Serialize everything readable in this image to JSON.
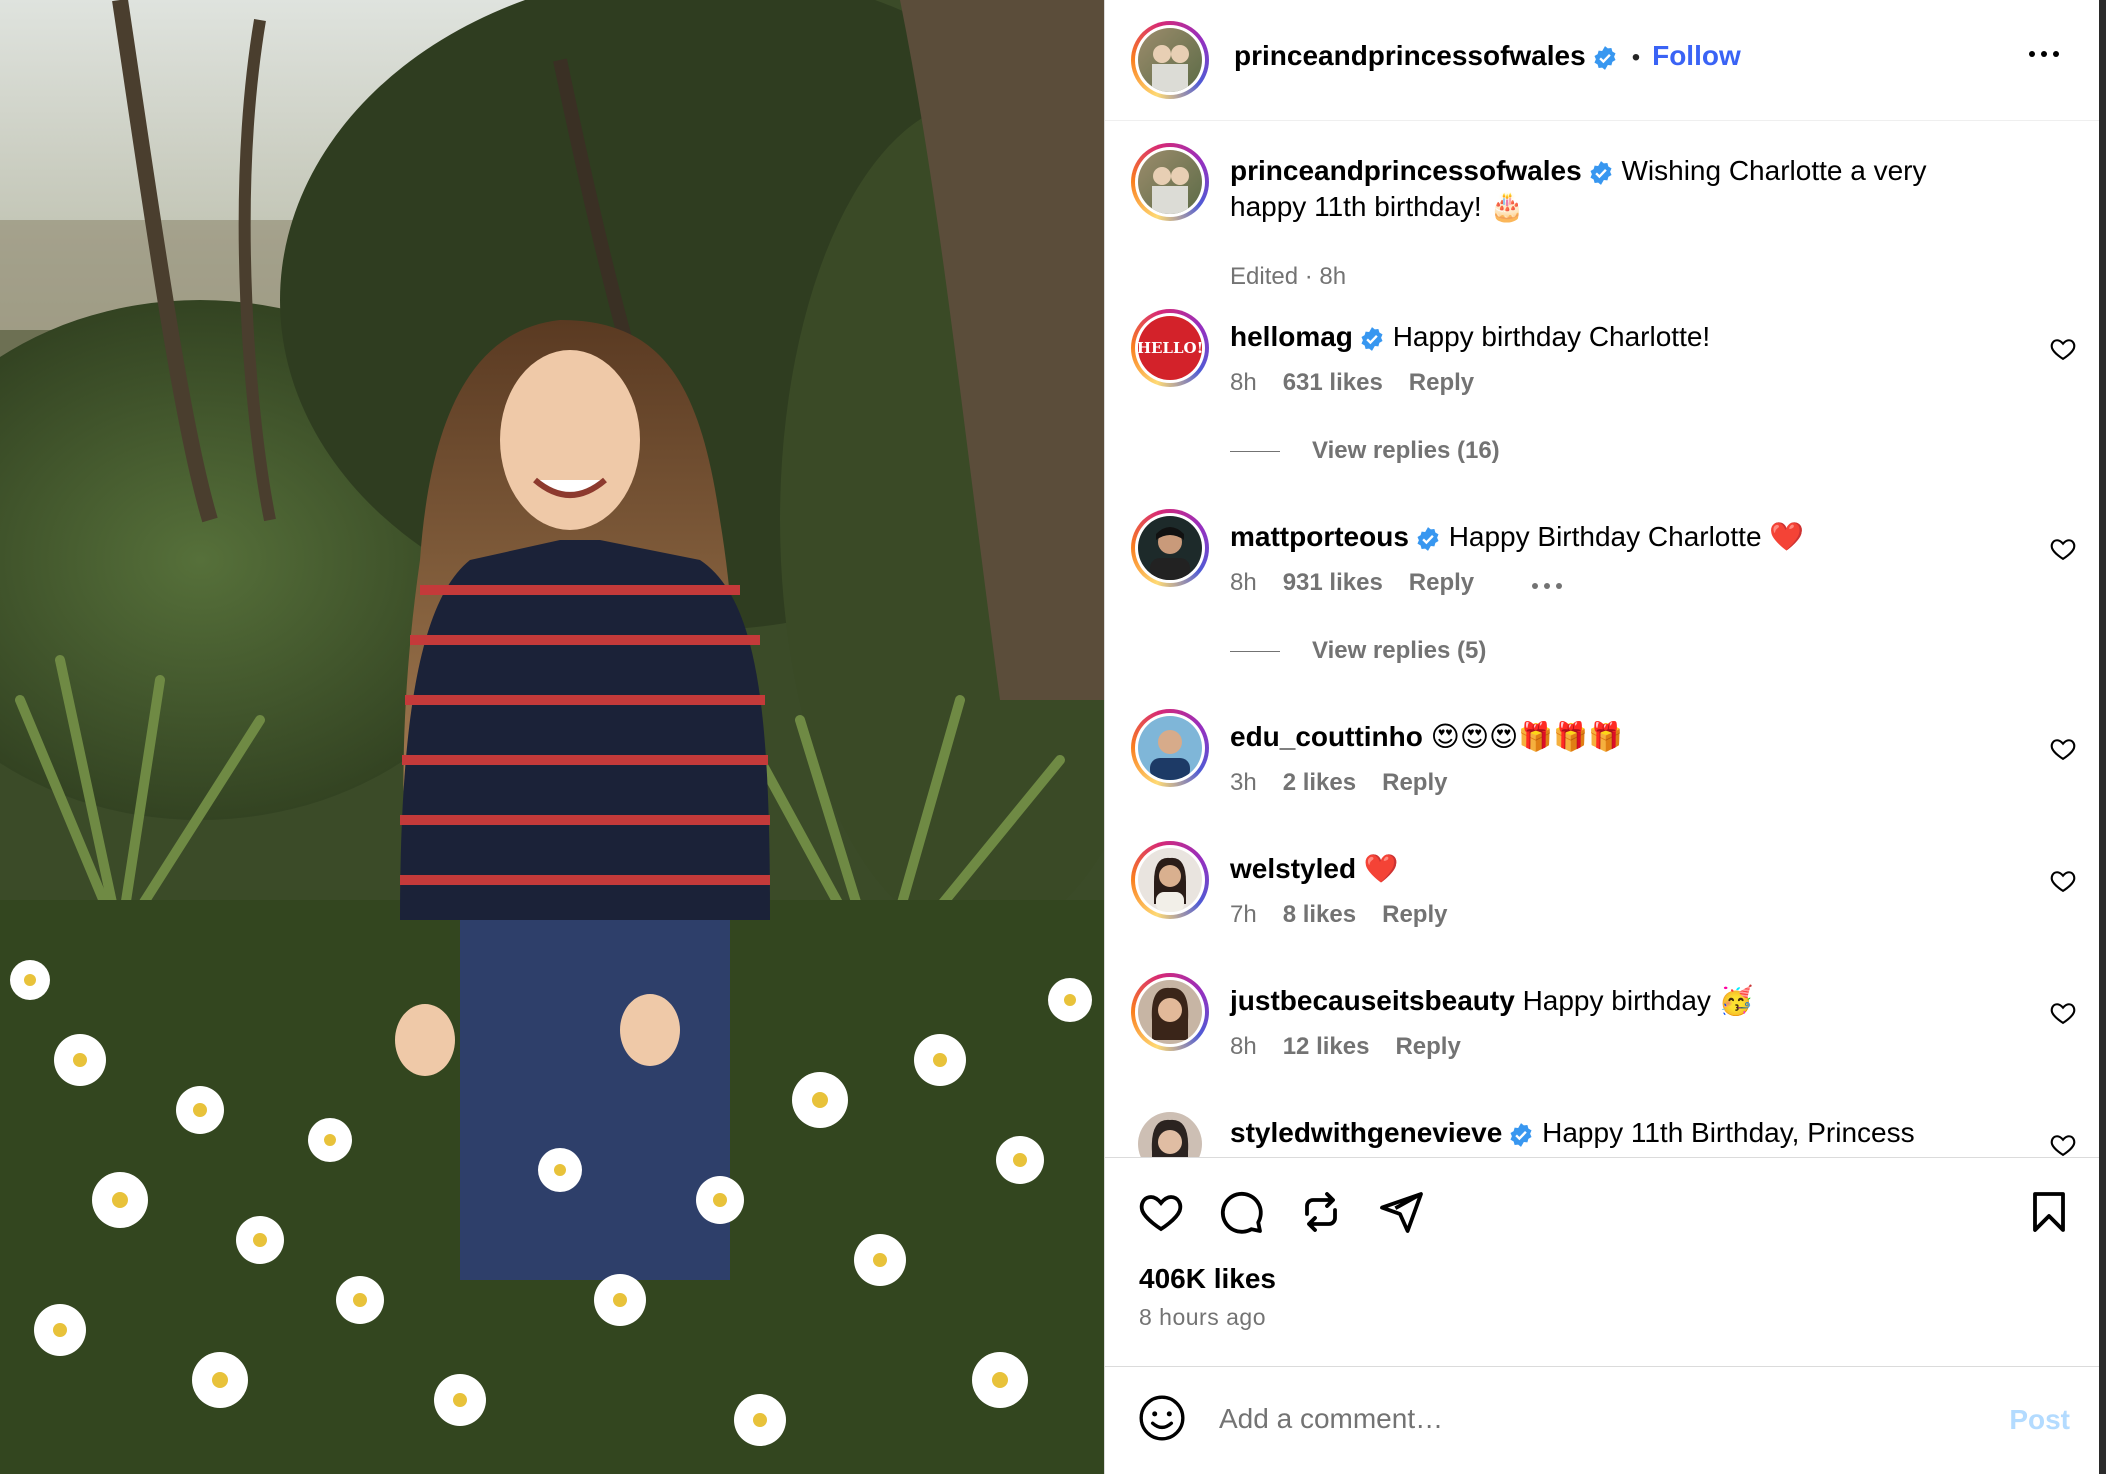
{
  "post": {
    "author": "princeandprincessofwales",
    "follow_label": "Follow",
    "dot": "•",
    "caption": "Wishing Charlotte a very happy 11th birthday! 🎂",
    "caption_meta": "Edited · 8h",
    "likes": "406K likes",
    "time_ago": "8 hours ago"
  },
  "comments": [
    {
      "username": "hellomag",
      "verified": true,
      "text": "Happy birthday Charlotte!",
      "time": "8h",
      "likes": "631 likes",
      "reply": "Reply",
      "view_replies": "View replies (16)",
      "avatar_text": "HELLO!"
    },
    {
      "username": "mattporteous",
      "verified": true,
      "text": "Happy Birthday Charlotte ❤️",
      "time": "8h",
      "likes": "931 likes",
      "reply": "Reply",
      "view_replies": "View replies (5)"
    },
    {
      "username": "edu_couttinho",
      "verified": false,
      "text": "😍😍😍🎁🎁🎁",
      "time": "3h",
      "likes": "2 likes",
      "reply": "Reply"
    },
    {
      "username": "welstyled",
      "verified": false,
      "text": "❤️",
      "time": "7h",
      "likes": "8 likes",
      "reply": "Reply"
    },
    {
      "username": "justbecauseitsbeauty",
      "verified": false,
      "text": "Happy birthday 🥳",
      "time": "8h",
      "likes": "12 likes",
      "reply": "Reply"
    },
    {
      "username": "styledwithgenevieve",
      "verified": true,
      "text": "Happy 11th Birthday, Princess"
    }
  ],
  "add_comment": {
    "placeholder": "Add a comment…",
    "post_label": "Post"
  },
  "colors": {
    "follow": "#3a63f5",
    "verified": "#3897f0",
    "post_disabled": "#b3dbff"
  }
}
